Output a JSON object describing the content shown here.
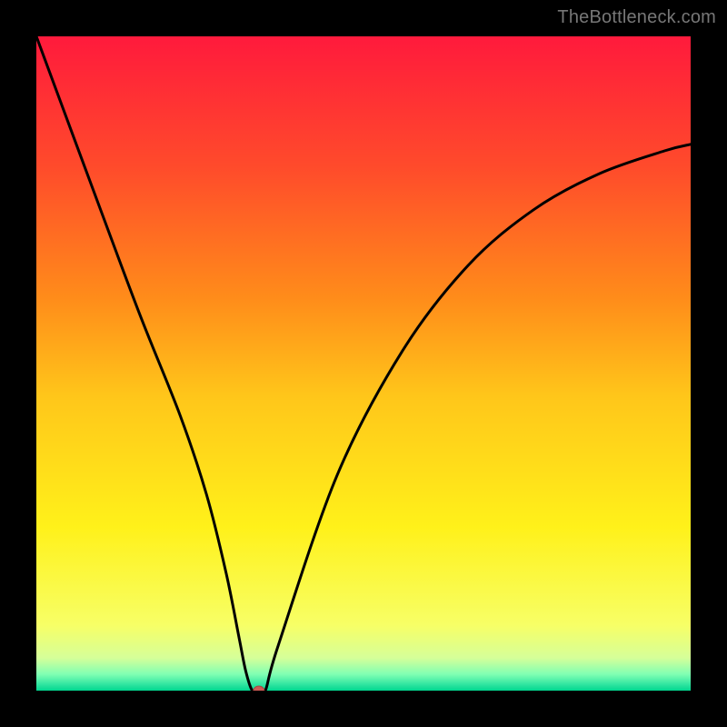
{
  "watermark": "TheBottleneck.com",
  "chart_data": {
    "type": "line",
    "title": "",
    "xlabel": "",
    "ylabel": "",
    "xlim": [
      0,
      100
    ],
    "ylim": [
      0,
      100
    ],
    "grid": false,
    "legend": false,
    "background_gradient": {
      "stops": [
        {
          "offset": 0.0,
          "color": "#ff1a3c"
        },
        {
          "offset": 0.2,
          "color": "#ff4b2b"
        },
        {
          "offset": 0.4,
          "color": "#ff8c1a"
        },
        {
          "offset": 0.55,
          "color": "#ffc61a"
        },
        {
          "offset": 0.75,
          "color": "#fff11a"
        },
        {
          "offset": 0.9,
          "color": "#f7ff66"
        },
        {
          "offset": 0.95,
          "color": "#d6ff99"
        },
        {
          "offset": 0.975,
          "color": "#80ffb3"
        },
        {
          "offset": 0.99,
          "color": "#33e6a1"
        },
        {
          "offset": 1.0,
          "color": "#00d68f"
        }
      ]
    },
    "series": [
      {
        "name": "bottleneck-curve",
        "x": [
          0,
          10,
          16,
          22,
          26,
          29,
          31,
          32,
          33,
          34,
          35,
          37,
          46,
          56,
          66,
          76,
          86,
          96,
          100
        ],
        "y": [
          100,
          73,
          57,
          42,
          30,
          18,
          8,
          3,
          0,
          0,
          0,
          7,
          33,
          52,
          65,
          73.5,
          79,
          82.5,
          83.5
        ]
      }
    ],
    "markers": [
      {
        "name": "optimum-marker",
        "x": 34,
        "y": 0,
        "shape": "ellipse",
        "rx": 6,
        "ry": 5,
        "fill": "#cc5a55",
        "stroke": "#a84641"
      }
    ]
  }
}
